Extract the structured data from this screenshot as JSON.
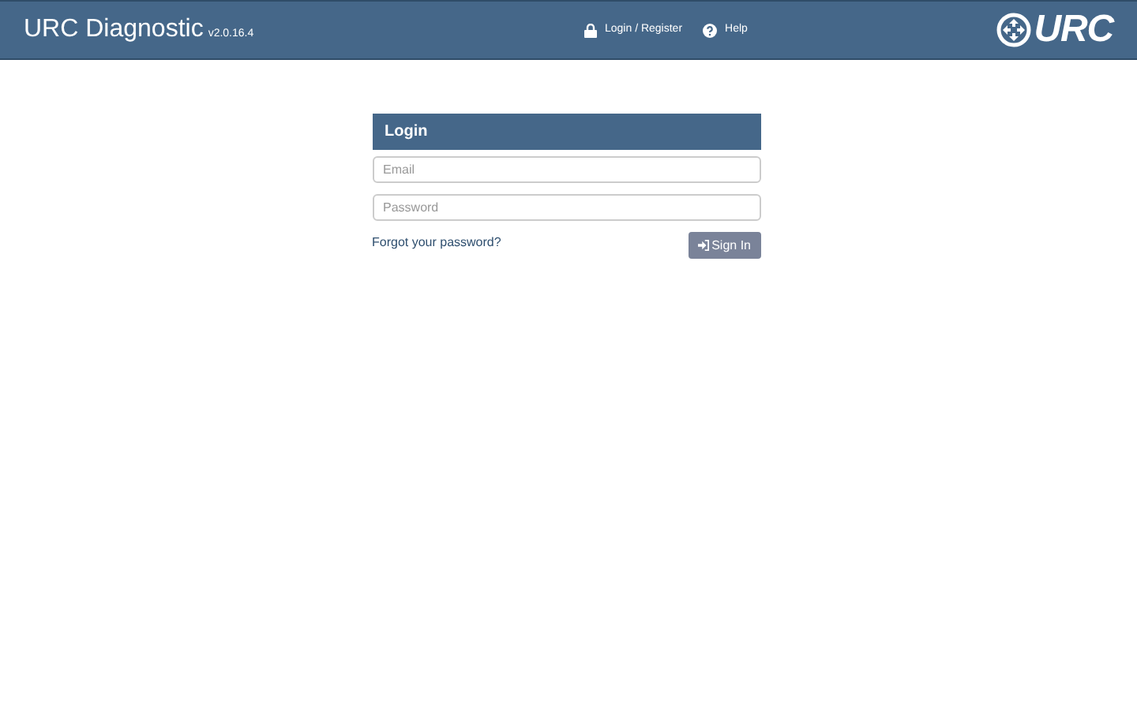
{
  "header": {
    "title": "URC Diagnostic",
    "version": "v2.0.16.4",
    "nav": [
      {
        "kind": "lock",
        "label": "Login / Register"
      },
      {
        "kind": "help",
        "label": "Help"
      }
    ],
    "logo_text": "URC"
  },
  "login": {
    "title": "Login",
    "fields": [
      {
        "placeholder": "Email"
      },
      {
        "placeholder": "Password"
      }
    ],
    "forgot_link": "Forgot your password?",
    "submit": "Sign In"
  }
}
